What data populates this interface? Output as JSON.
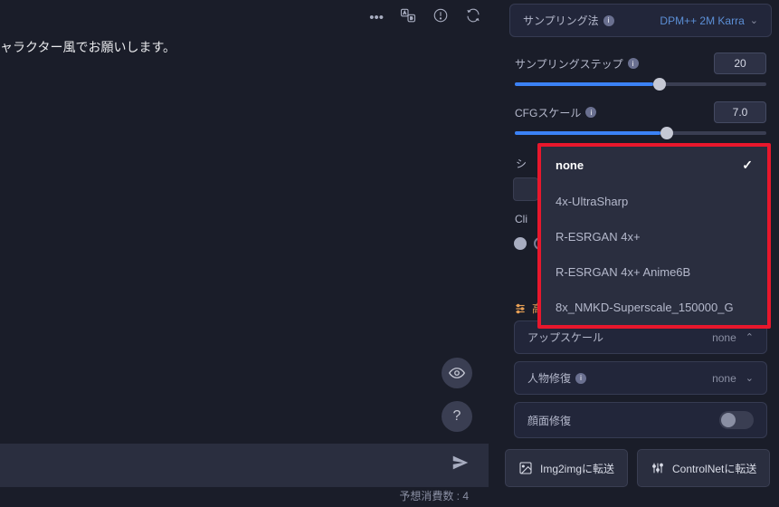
{
  "prompt_text": "ャラクター風でお願いします。",
  "counter_label": "予想消費数 : 4",
  "params": {
    "sampler": {
      "label": "サンプリング法",
      "value": "DPM++ 2M Karra"
    },
    "steps": {
      "label": "サンプリングステップ",
      "value": "20",
      "pct": 55
    },
    "cfg": {
      "label": "CFGスケール",
      "value": "7.0",
      "pct": 58
    },
    "seed_label": "シ",
    "clip_label": "Cli",
    "upscale": {
      "label": "アップスケール",
      "value": "none"
    },
    "face_restore": {
      "label": "人物修復",
      "value": "none"
    },
    "face_fix_label": "顔面修復",
    "section_header": "高"
  },
  "dropdown": {
    "items": [
      "none",
      "4x-UltraSharp",
      "R-ESRGAN 4x+",
      "R-ESRGAN 4x+ Anime6B",
      "8x_NMKD-Superscale_150000_G"
    ],
    "selected_index": 0
  },
  "bottom": {
    "img2img": "Img2imgに転送",
    "controlnet": "ControlNetに転送"
  }
}
